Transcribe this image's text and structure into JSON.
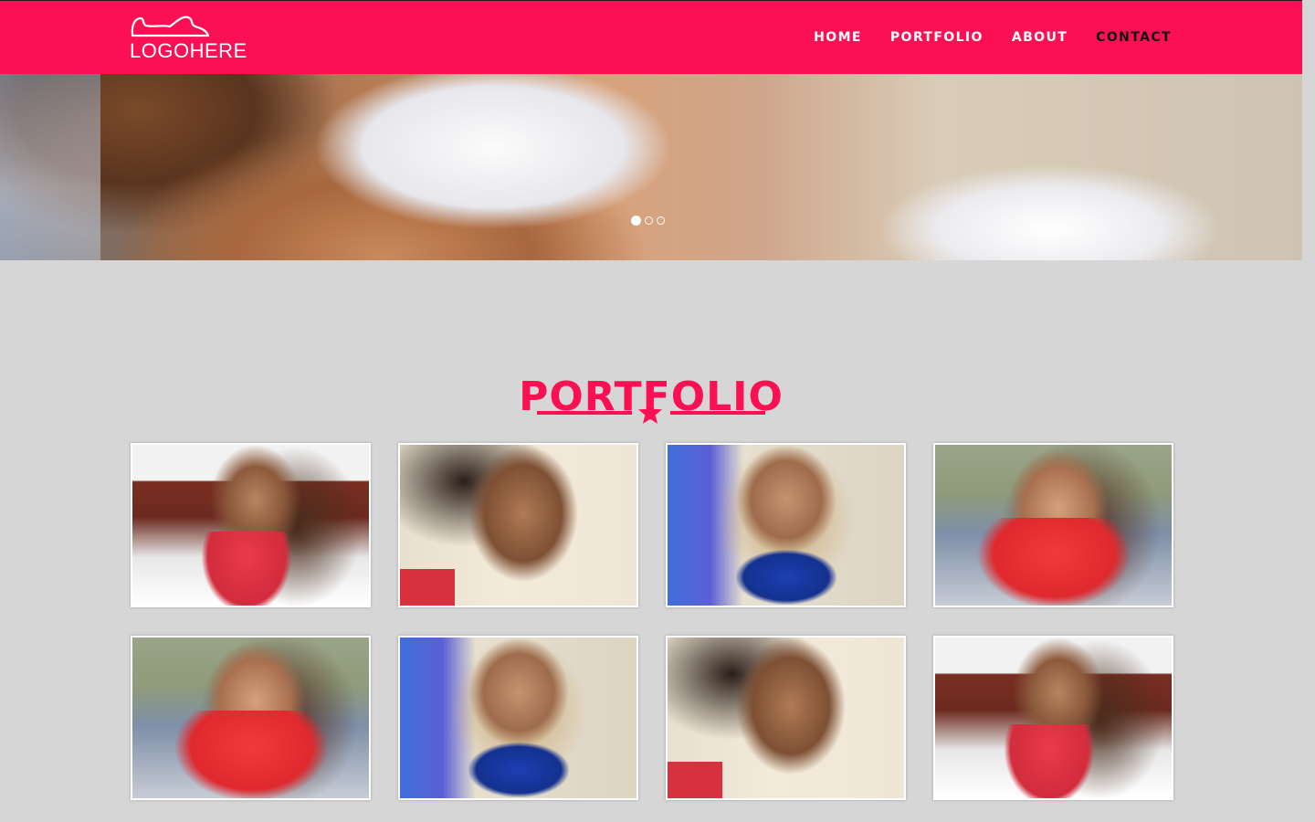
{
  "header": {
    "logo_text": "LOGOHERE",
    "nav": [
      "HOME",
      "PORTFOLIO",
      "ABOUT",
      "CONTACT"
    ],
    "active_index": 3
  },
  "hero": {
    "slides": 3,
    "active_slide": 1
  },
  "portfolio": {
    "title": "PORTFOLIO",
    "divider_icon": "star-icon",
    "items": [
      {
        "photo": "p1"
      },
      {
        "photo": "p2"
      },
      {
        "photo": "p3"
      },
      {
        "photo": "p4"
      },
      {
        "photo": "p4"
      },
      {
        "photo": "p3"
      },
      {
        "photo": "p2"
      },
      {
        "photo": "p1"
      }
    ]
  },
  "colors": {
    "brand": "#fb1153",
    "background": "#d6d6d6"
  }
}
